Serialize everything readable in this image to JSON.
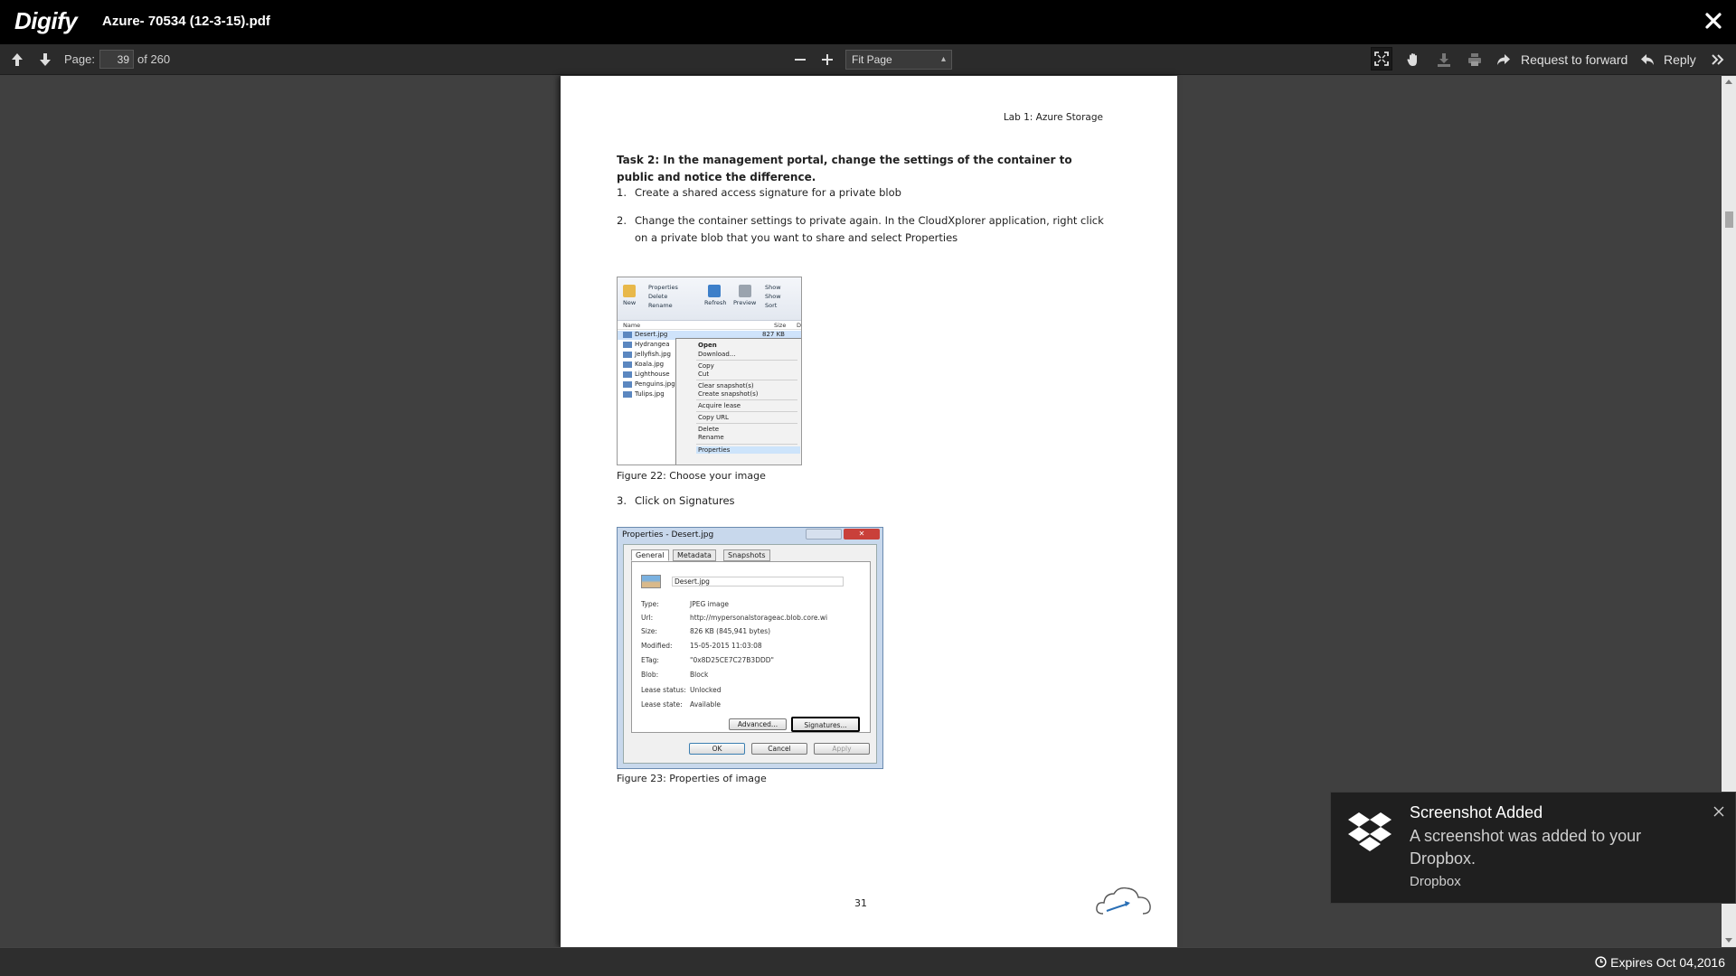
{
  "app": {
    "logo": "Digify",
    "document_title": "Azure- 70534 (12-3-15).pdf"
  },
  "toolbar": {
    "page_label": "Page:",
    "current_page": "39",
    "page_total": "of 260",
    "zoom_value": "Fit Page",
    "request_forward_label": "Request to forward",
    "reply_label": "Reply"
  },
  "pdf": {
    "header": "Lab 1: Azure Storage",
    "task_heading": "Task 2: In the management portal, change the settings of the container to public and notice the difference.",
    "steps": [
      {
        "num": "1.",
        "text": "Create a shared access signature for a private blob"
      },
      {
        "num": "2.",
        "text": "Change the container settings to private again. In the CloudXplorer application, right click on a private blob that you want to share and select Properties"
      },
      {
        "num": "3.",
        "text": "Click on Signatures"
      }
    ],
    "figure22_caption": "Figure 22: Choose your image",
    "figure23_caption": "Figure 23: Properties of image",
    "page_number": "31",
    "fig22": {
      "ribbon": [
        "New",
        "Properties",
        "Delete",
        "Rename",
        "Refresh",
        "Preview",
        "Show",
        "Show",
        "Sort"
      ],
      "columns": [
        "Name",
        "Size",
        "D"
      ],
      "files": [
        "Desert.jpg",
        "Hydrangea",
        "Jellyfish.jpg",
        "Koala.jpg",
        "Lighthouse",
        "Penguins.jpg",
        "Tulips.jpg"
      ],
      "first_size": "827 KB",
      "menu": [
        "Open",
        "Download...",
        "Copy",
        "Cut",
        "Clear snapshot(s)",
        "Create snapshot(s)",
        "Acquire lease",
        "Copy URL",
        "Delete",
        "Rename",
        "Properties"
      ]
    },
    "fig23": {
      "title": "Properties - Desert.jpg",
      "tabs": [
        "General",
        "Metadata",
        "Snapshots"
      ],
      "name": "Desert.jpg",
      "props": [
        {
          "label": "Type:",
          "value": "JPEG image"
        },
        {
          "label": "Url:",
          "value": "http://mypersonalstorageac.blob.core.wi"
        },
        {
          "label": "Size:",
          "value": "826 KB (845,941 bytes)"
        },
        {
          "label": "Modified:",
          "value": "15-05-2015 11:03:08"
        },
        {
          "label": "ETag:",
          "value": "\"0x8D25CE7C27B3DDD\""
        },
        {
          "label": "Blob:",
          "value": "Block"
        },
        {
          "label": "Lease status:",
          "value": "Unlocked"
        },
        {
          "label": "Lease state:",
          "value": "Available"
        }
      ],
      "advanced": "Advanced...",
      "signatures": "Signatures...",
      "ok": "OK",
      "cancel": "Cancel",
      "apply": "Apply"
    }
  },
  "footer": {
    "expires": "Expires Oct 04,2016"
  },
  "toast": {
    "title": "Screenshot Added",
    "message": "A screenshot was added to your Dropbox.",
    "source": "Dropbox"
  },
  "colors": {
    "topbar": "#000000",
    "toolbar": "#2b2b2b",
    "viewer_bg": "#404040",
    "toast_bg": "#1f1f1f"
  },
  "icons": [
    "arrow-up-icon",
    "arrow-down-icon",
    "minus-icon",
    "plus-icon",
    "fullscreen-icon",
    "hand-icon",
    "download-icon",
    "print-icon",
    "forward-icon",
    "reply-icon",
    "chevrons-right-icon",
    "close-icon",
    "clock-icon",
    "dropbox-icon"
  ]
}
